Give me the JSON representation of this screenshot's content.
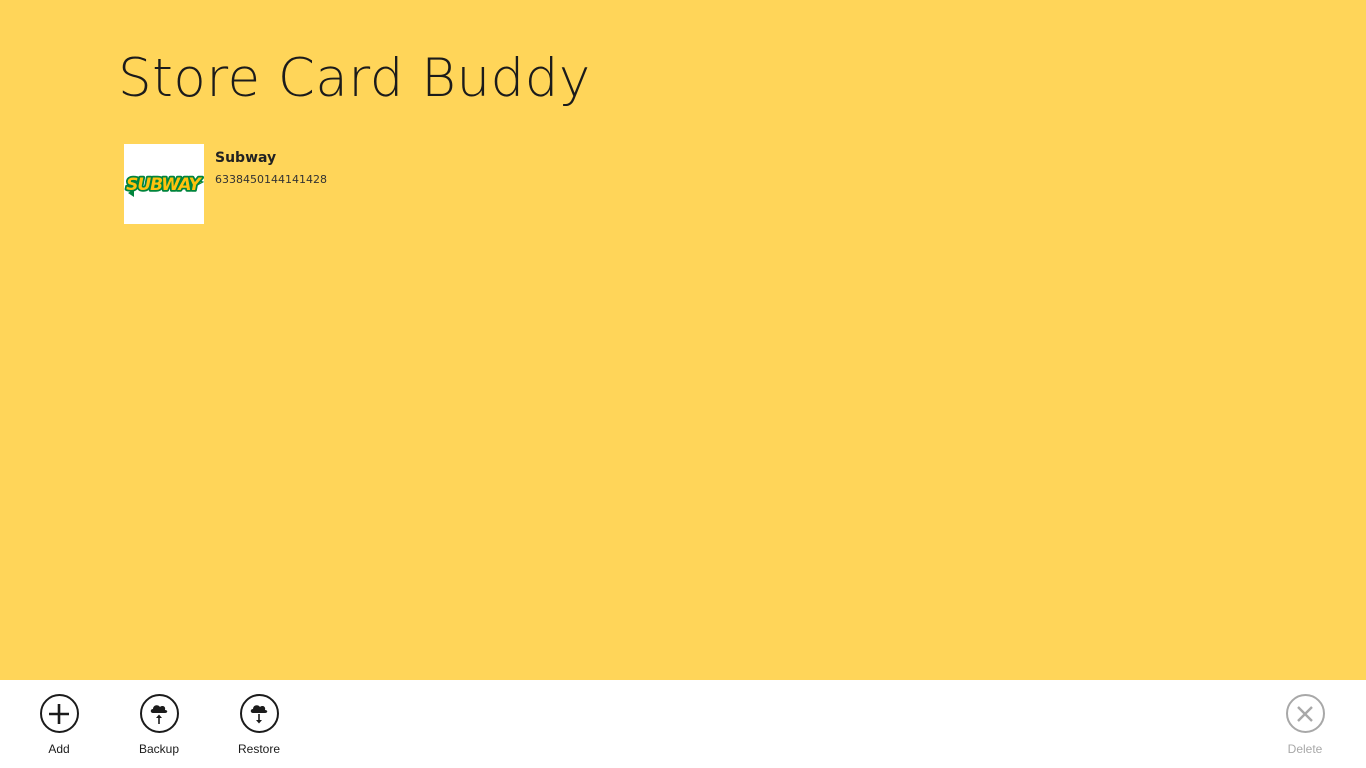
{
  "app": {
    "title": "Store Card Buddy"
  },
  "cards": [
    {
      "name": "Subway",
      "number": "6338450144141428",
      "logo_text": "SUBWAY"
    }
  ],
  "appbar": {
    "add_label": "Add",
    "backup_label": "Backup",
    "restore_label": "Restore",
    "delete_label": "Delete"
  },
  "colors": {
    "background": "#FFD559",
    "appbar": "#FFFFFF",
    "subway_green": "#00843D",
    "subway_yellow": "#FFC20E",
    "disabled": "#A8A8A8"
  },
  "icons": [
    "add-icon",
    "backup-icon",
    "restore-icon",
    "delete-icon"
  ]
}
